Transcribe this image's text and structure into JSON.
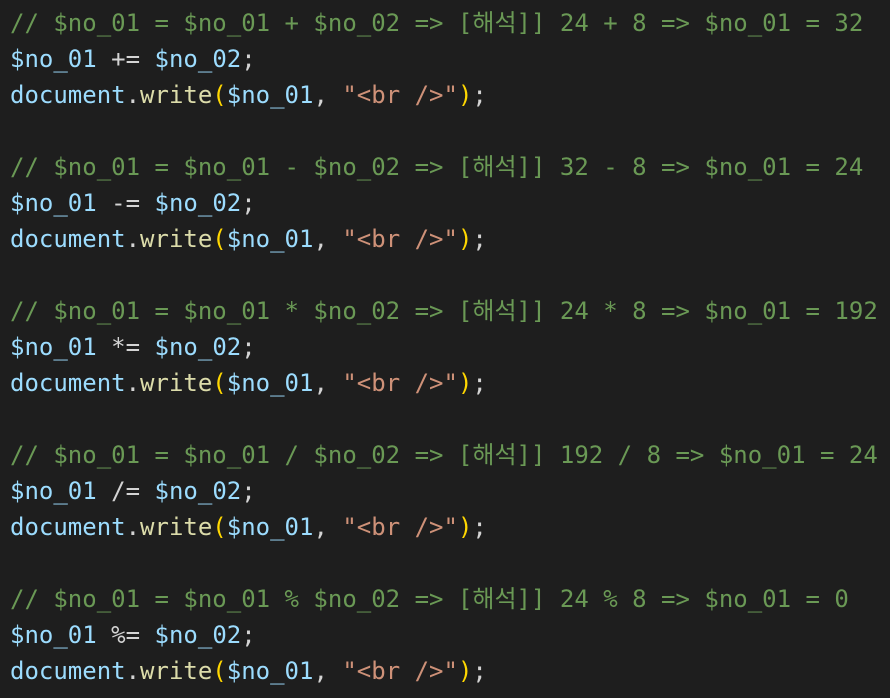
{
  "editor": {
    "blocks": [
      {
        "comment": "// $no_01 = $no_01 + $no_02 => [해석]] 24 + 8 => $no_01 = 32",
        "assign": {
          "lhs": "$no_01",
          "op": "+=",
          "rhs": "$no_02",
          "end": ";"
        },
        "write": {
          "obj": "document",
          "dot": ".",
          "method": "write",
          "open": "(",
          "arg": "$no_01",
          "comma": ", ",
          "str": "\"<br />\"",
          "close": ")",
          "end": ";"
        }
      },
      {
        "comment": "// $no_01 = $no_01 - $no_02 => [해석]] 32 - 8 => $no_01 = 24",
        "assign": {
          "lhs": "$no_01",
          "op": "-=",
          "rhs": "$no_02",
          "end": ";"
        },
        "write": {
          "obj": "document",
          "dot": ".",
          "method": "write",
          "open": "(",
          "arg": "$no_01",
          "comma": ", ",
          "str": "\"<br />\"",
          "close": ")",
          "end": ";"
        }
      },
      {
        "comment": "// $no_01 = $no_01 * $no_02 => [해석]] 24 * 8 => $no_01 = 192",
        "assign": {
          "lhs": "$no_01",
          "op": "*=",
          "rhs": "$no_02",
          "end": ";"
        },
        "write": {
          "obj": "document",
          "dot": ".",
          "method": "write",
          "open": "(",
          "arg": "$no_01",
          "comma": ", ",
          "str": "\"<br />\"",
          "close": ")",
          "end": ";"
        }
      },
      {
        "comment": "// $no_01 = $no_01 / $no_02 => [해석]] 192 / 8 => $no_01 = 24",
        "assign": {
          "lhs": "$no_01",
          "op": "/=",
          "rhs": "$no_02",
          "end": ";"
        },
        "write": {
          "obj": "document",
          "dot": ".",
          "method": "write",
          "open": "(",
          "arg": "$no_01",
          "comma": ", ",
          "str": "\"<br />\"",
          "close": ")",
          "end": ";"
        }
      },
      {
        "comment": "// $no_01 = $no_01 % $no_02 => [해석]] 24 % 8 => $no_01 = 0",
        "assign": {
          "lhs": "$no_01",
          "op": "%=",
          "rhs": "$no_02",
          "end": ";"
        },
        "write": {
          "obj": "document",
          "dot": ".",
          "method": "write",
          "open": "(",
          "arg": "$no_01",
          "comma": ", ",
          "str": "\"<br />\"",
          "close": ")",
          "end": ";"
        }
      }
    ]
  },
  "colors": {
    "background": "#1e1e1e",
    "comment": "#6a9955",
    "variable": "#9cdcfe",
    "operator": "#d4d4d4",
    "function": "#dcdcaa",
    "bracket": "#ffd700",
    "string": "#ce9178"
  }
}
